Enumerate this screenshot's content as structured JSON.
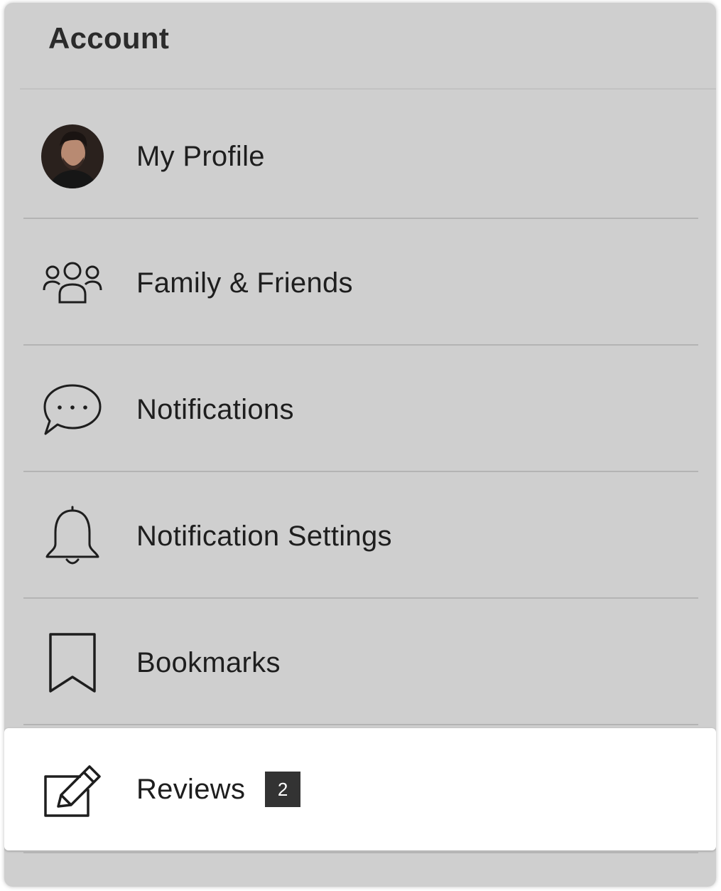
{
  "header": {
    "title": "Account"
  },
  "menu": {
    "items": [
      {
        "label": "My Profile",
        "icon": "avatar"
      },
      {
        "label": "Family & Friends",
        "icon": "group-icon"
      },
      {
        "label": "Notifications",
        "icon": "chat-bubble-icon"
      },
      {
        "label": "Notification Settings",
        "icon": "bell-icon"
      },
      {
        "label": "Bookmarks",
        "icon": "bookmark-icon"
      },
      {
        "label": "Reviews",
        "icon": "edit-icon",
        "badge": "2",
        "selected": true
      }
    ]
  },
  "colors": {
    "panel_background": "#cfcfcf",
    "selected_background": "#ffffff",
    "badge_background": "#333333",
    "text": "#1e1e1e"
  }
}
